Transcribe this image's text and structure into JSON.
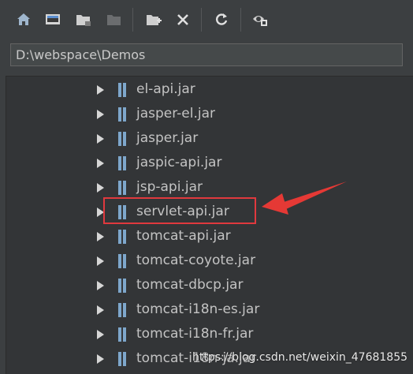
{
  "toolbar": {
    "buttons": [
      {
        "name": "home-icon"
      },
      {
        "name": "desktop-icon"
      },
      {
        "name": "folder-icon"
      },
      {
        "name": "folder-disabled-icon"
      },
      {
        "name": "new-folder-icon"
      },
      {
        "name": "delete-icon"
      },
      {
        "name": "refresh-icon"
      },
      {
        "name": "show-hidden-icon"
      }
    ]
  },
  "path": {
    "value": "D:\\webspace\\Demos"
  },
  "tree": {
    "items": [
      {
        "label": "el-api.jar"
      },
      {
        "label": "jasper-el.jar"
      },
      {
        "label": "jasper.jar"
      },
      {
        "label": "jaspic-api.jar"
      },
      {
        "label": "jsp-api.jar"
      },
      {
        "label": "servlet-api.jar"
      },
      {
        "label": "tomcat-api.jar"
      },
      {
        "label": "tomcat-coyote.jar"
      },
      {
        "label": "tomcat-dbcp.jar"
      },
      {
        "label": "tomcat-i18n-es.jar"
      },
      {
        "label": "tomcat-i18n-fr.jar"
      },
      {
        "label": "tomcat-i18n-ja.jar"
      }
    ]
  },
  "annotation": {
    "highlight_color": "#e0393e",
    "arrow_color": "#e53935"
  },
  "watermark": {
    "text": "https://blog.csdn.net/weixin_47681855"
  }
}
